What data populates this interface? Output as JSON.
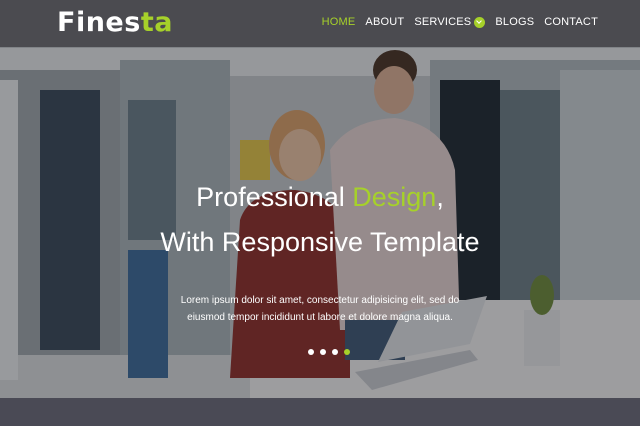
{
  "brand": {
    "name_part1": "Fines",
    "name_part2": "ta",
    "accent_color": "#a6d12a"
  },
  "nav": {
    "items": [
      {
        "label": "HOME",
        "active": true
      },
      {
        "label": "ABOUT",
        "active": false
      },
      {
        "label": "SERVICES",
        "active": false,
        "has_dropdown": true,
        "icon": "chevron-down-icon"
      },
      {
        "label": "BLOGS",
        "active": false
      },
      {
        "label": "CONTACT",
        "active": false
      }
    ]
  },
  "hero": {
    "title_line1_prefix": "Professional ",
    "title_line1_accent": "Design",
    "title_line1_suffix": ",",
    "title_line2": "With Responsive Template",
    "description_line1": "Lorem ipsum dolor sit amet, consectetur adipisicing elit, sed do",
    "description_line2": "eiusmod tempor incididunt ut labore et dolore magna aliqua.",
    "slides_count": 4,
    "active_slide": 4
  }
}
